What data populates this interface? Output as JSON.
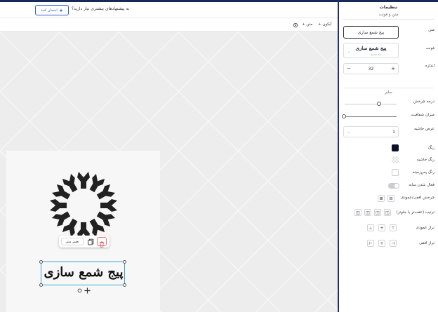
{
  "hint": {
    "text": "به پیشنهادهای بیشتری نیاز دارید؟",
    "button_label": "امتحان کنید"
  },
  "toolbar": {
    "add_icon_label": "آیکون",
    "add_text_label": "متن"
  },
  "canvas": {
    "selected_text": "پیج شمع سازی",
    "context_menu": {
      "change_text_label": "تغییر متن"
    }
  },
  "panel": {
    "title": "تنظیمات",
    "section_text_font": "متن و فونت",
    "text_label": "متن",
    "text_value": "پیج شمع سازی",
    "font_label": "فونت",
    "font_preview": "پیج شمع سازی",
    "font_name": "Naskh-Ext",
    "size_label": "اندازه",
    "size_value": "32",
    "section_other": "سایر",
    "rotation_label": "درجه چرخش",
    "rotation_value": 0,
    "opacity_label": "میزان شفافیت",
    "opacity_value": 0,
    "stroke_width_label": "عرض حاشیه",
    "stroke_width_value": "1",
    "color_label": "رنگ",
    "stroke_color_label": "رنگ حاشیه",
    "bg_color_label": "رنگ پس‌زمینه",
    "shadow_label": "فعال شدن سایه",
    "flip_label": "چرخش افقی/عمودی",
    "order_label": "ترتیب (عقب‌تر یا جلوتر)",
    "valign_label": "تراز عمودی",
    "halign_label": "تراز افقی"
  },
  "colors": {
    "accent": "#2f5bd3",
    "brand_dark": "#1f2f73",
    "text_color": "#0b1026",
    "selection": "#36a5d6",
    "delete": "#f07474"
  },
  "icons": [
    "sparkle-icon",
    "plus-icon",
    "gear-icon",
    "copy-icon",
    "trash-icon",
    "rotate-icon",
    "move-icon",
    "chevron-down-icon",
    "minus-icon",
    "flip-icon",
    "layer-order-icon",
    "align-icon"
  ]
}
